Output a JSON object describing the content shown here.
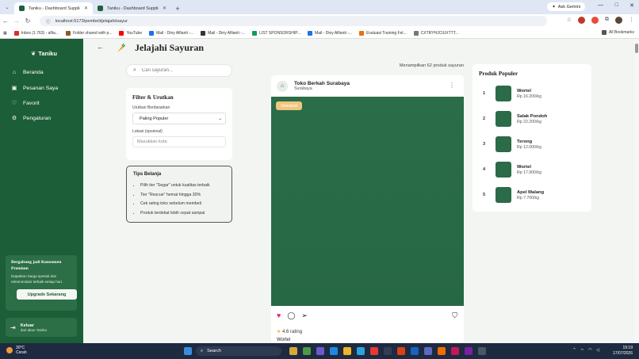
{
  "browser": {
    "tabs": [
      {
        "title": "Taniku - Dashboard Supplier",
        "active": true
      },
      {
        "title": "Taniku - Dashboard Supplier",
        "active": false
      }
    ],
    "ask_gemini": "Ask Gemini",
    "url": "localhost:5173/pembeli/jelajahi/sayur",
    "bookmarks": [
      {
        "label": "Inbox (1.763) - alfia...",
        "color": "#d93025"
      },
      {
        "label": "Folder shared with p...",
        "color": "#8a5a2b"
      },
      {
        "label": "YouTube",
        "color": "#ff0000"
      },
      {
        "label": "Mail - Diny Alfianti -...",
        "color": "#1a73e8"
      },
      {
        "label": "Mail - Diny Alfianti -...",
        "color": "#333333"
      },
      {
        "label": "LIST SPONSORSHIP...",
        "color": "#0f9d58"
      },
      {
        "label": "Mail - Diny Alfianti -...",
        "color": "#1a73e8"
      },
      {
        "label": "Evaluasi Training Fel...",
        "color": "#e8710a"
      },
      {
        "label": "CXTRYHJCIUXTTT...",
        "color": "#555555"
      }
    ],
    "all_bookmarks": "All Bookmarks"
  },
  "sidebar": {
    "brand": "Taniku",
    "items": [
      {
        "label": "Beranda",
        "icon": "home-icon"
      },
      {
        "label": "Pesanan Saya",
        "icon": "bag-icon"
      },
      {
        "label": "Favorit",
        "icon": "heart-icon"
      },
      {
        "label": "Pengaturan",
        "icon": "gear-icon"
      }
    ],
    "promo": {
      "title": "Bergabung jadi Konsumen Premium",
      "desc": "Dapatkan harga spesial dan rekomendasi terbaik setiap hari.",
      "button": "Upgrade Sekarang"
    },
    "logout": {
      "title": "Keluar",
      "subtitle": "dari akun Taniku"
    }
  },
  "page": {
    "title": "Jelajahi Sayuran",
    "search_placeholder": "Cari sayuran...",
    "filter": {
      "title": "Filter & Urutkan",
      "sort_label": "Urutkan Berdasarkan",
      "sort_value": "Paling Populer",
      "location_label": "Lokasi (opsional)",
      "location_placeholder": "Masukkan kota"
    },
    "tips": {
      "title": "Tips Belanja",
      "items": [
        "Pilih tier \"Segar\" untuk kualitas terbaik",
        "Tier \"Rescue\" hemat hingga 30%",
        "Cek rating toko sebelum membeli",
        "Produk terdekat lebih cepat sampai"
      ]
    },
    "count_text": "Menampilkan 62 produk sayuran",
    "post": {
      "store": "Toko Berkah Surabaya",
      "city": "Surabaya",
      "badge": "Standard",
      "rating": "4.6 rating",
      "product": "Wortel"
    },
    "popular": {
      "title": "Produk Populer",
      "items": [
        {
          "rank": "1",
          "name": "Wortel",
          "price": "Rp 16.200/kg"
        },
        {
          "rank": "2",
          "name": "Salak Pondoh",
          "price": "Rp 22.200/kg"
        },
        {
          "rank": "3",
          "name": "Terong",
          "price": "Rp 12.000/kg"
        },
        {
          "rank": "4",
          "name": "Wortel",
          "price": "Rp 17.900/kg"
        },
        {
          "rank": "5",
          "name": "Apel Malang",
          "price": "Rp 7.700/kg"
        }
      ]
    }
  },
  "taskbar": {
    "temp": "30°C",
    "weather": "Cerah",
    "search": "Search",
    "time": "19:19",
    "date": "17/07/2026"
  },
  "colors": {
    "primary": "#1c5e37",
    "badge": "#f1c57d",
    "heart": "#e0245e"
  }
}
